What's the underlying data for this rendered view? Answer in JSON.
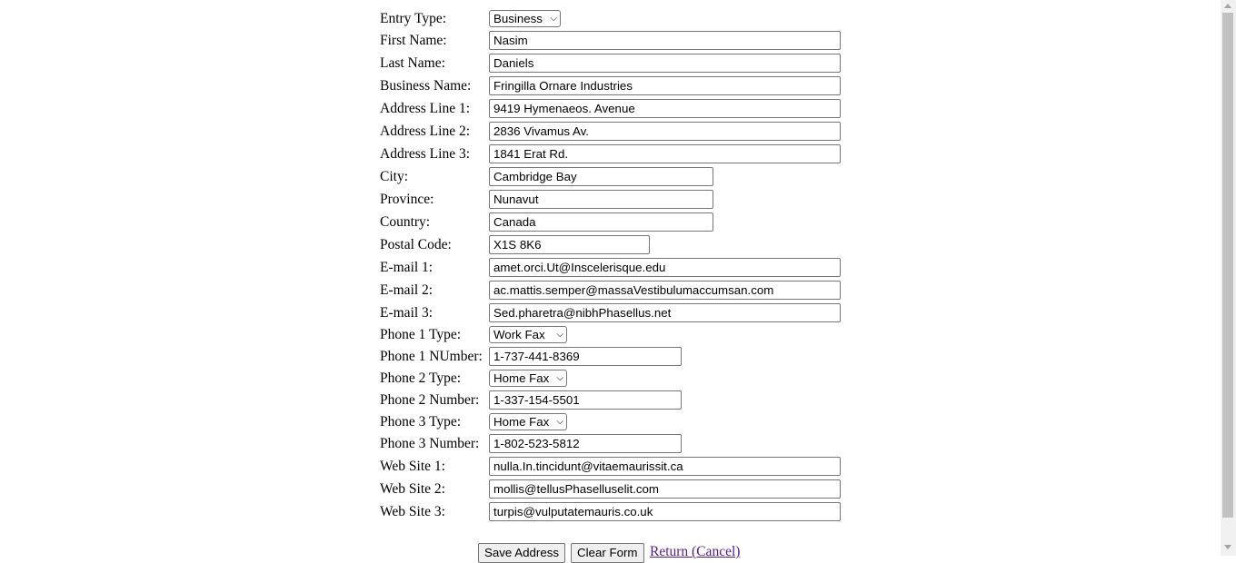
{
  "labels": {
    "entry_type": "Entry Type:",
    "first_name": "First Name:",
    "last_name": "Last Name:",
    "business_name": "Business Name:",
    "address1": "Address Line 1:",
    "address2": "Address Line 2:",
    "address3": "Address Line 3:",
    "city": "City:",
    "province": "Province:",
    "country": "Country:",
    "postal": "Postal Code:",
    "email1": "E-mail 1:",
    "email2": "E-mail 2:",
    "email3": "E-mail 3:",
    "phone1_type": "Phone 1 Type:",
    "phone1_number": "Phone 1 NUmber:",
    "phone2_type": "Phone 2 Type:",
    "phone2_number": "Phone 2 Number:",
    "phone3_type": "Phone 3 Type:",
    "phone3_number": "Phone 3 Number:",
    "web1": "Web Site 1:",
    "web2": "Web Site 2:",
    "web3": "Web Site 3:"
  },
  "values": {
    "entry_type": "Business",
    "first_name": "Nasim",
    "last_name": "Daniels",
    "business_name": "Fringilla Ornare Industries",
    "address1": "9419 Hymenaeos. Avenue",
    "address2": "2836 Vivamus Av.",
    "address3": "1841 Erat Rd.",
    "city": "Cambridge Bay",
    "province": "Nunavut",
    "country": "Canada",
    "postal": "X1S 8K6",
    "email1": "amet.orci.Ut@Inscelerisque.edu",
    "email2": "ac.mattis.semper@massaVestibulumaccumsan.com",
    "email3": "Sed.pharetra@nibhPhasellus.net",
    "phone1_type": "Work Fax",
    "phone1_number": "1-737-441-8369",
    "phone2_type": "Home Fax",
    "phone2_number": "1-337-154-5501",
    "phone3_type": "Home Fax",
    "phone3_number": "1-802-523-5812",
    "web1": "nulla.In.tincidunt@vitaemaurissit.ca",
    "web2": "mollis@tellusPhaselluselit.com",
    "web3": "turpis@vulputatemauris.co.uk"
  },
  "buttons": {
    "save": "Save Address",
    "clear": "Clear Form",
    "return": "Return (Cancel)"
  },
  "icons": {
    "dropdown": "chevron-down-icon"
  }
}
